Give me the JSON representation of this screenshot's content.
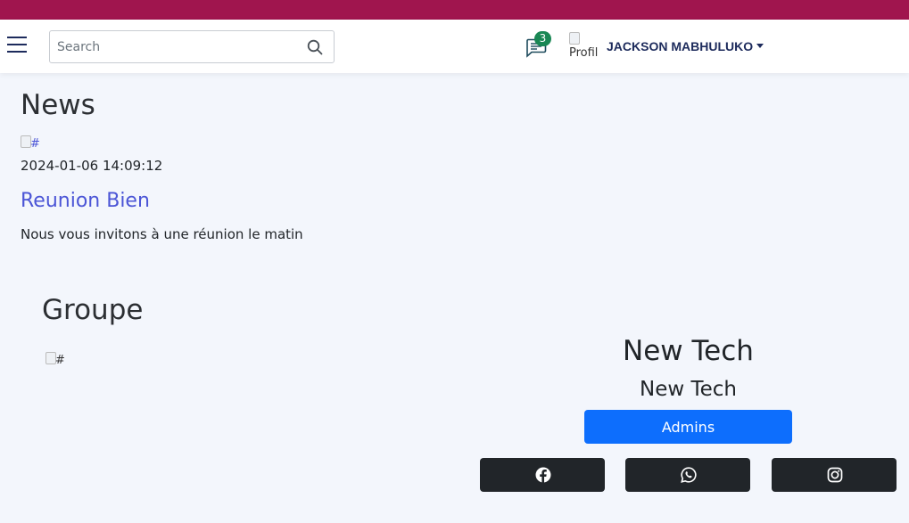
{
  "colors": {
    "topbar": "#a0154e",
    "navbar": "#ffffff",
    "page_bg": "#f3f6fc",
    "link": "#4b55d6",
    "primary_button": "#0d6efd",
    "social_button": "#212529",
    "badge": "#198754",
    "user_name": "#1d2b5c"
  },
  "header": {
    "search_placeholder": "Search",
    "messages_icon": "chat-left-text-icon",
    "messages_badge": "3",
    "avatar_alt": "Profil",
    "user_name": "JACKSON MABHULUKO"
  },
  "news": {
    "title": "News",
    "image_alt": "#",
    "date": "2024-01-06 14:09:12",
    "headline": "Reunion Bien",
    "body": "Nous vous invitons à une réunion le matin"
  },
  "group": {
    "title": "Groupe",
    "image_alt": "#",
    "name": "New Tech",
    "subtitle": "New Tech",
    "admins_label": "Admins",
    "social_icons": [
      "facebook-icon",
      "whatsapp-icon",
      "instagram-icon"
    ]
  }
}
